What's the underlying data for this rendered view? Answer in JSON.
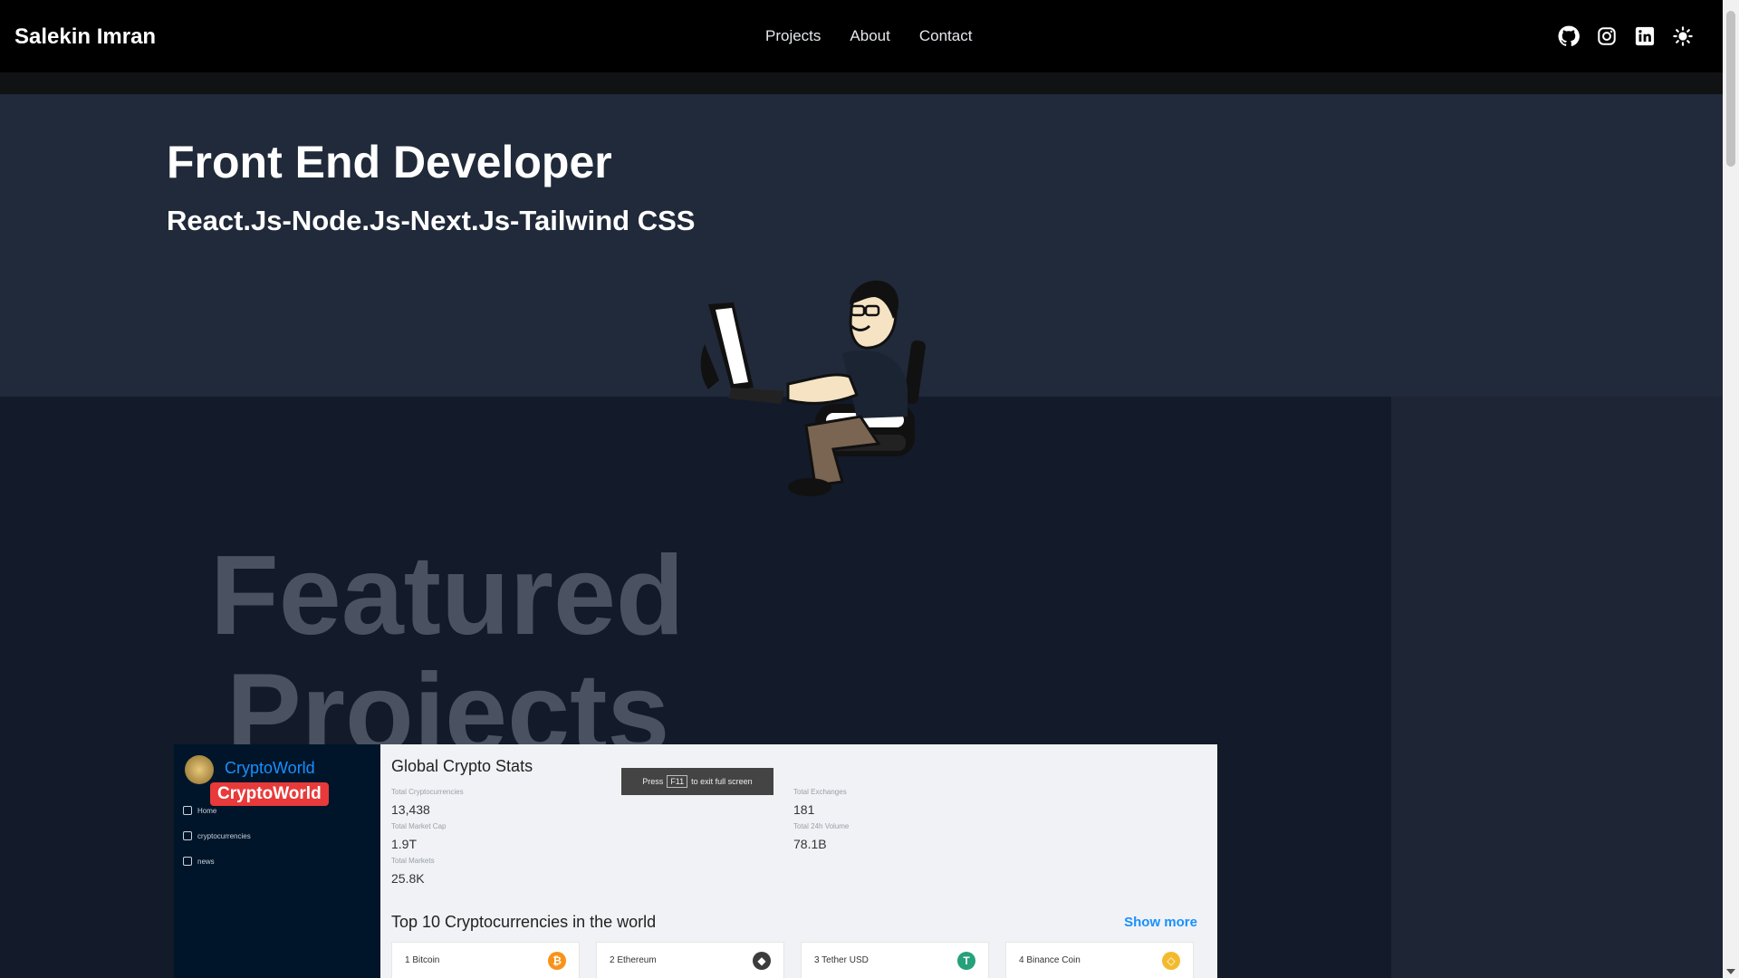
{
  "nav": {
    "brand": "Salekin Imran",
    "links": [
      "Projects",
      "About",
      "Contact"
    ],
    "icons": [
      "github-icon",
      "instagram-icon",
      "linkedin-icon",
      "sun-icon"
    ]
  },
  "hero": {
    "title": "Front End Developer",
    "subtitle": "React.Js-Node.Js-Next.Js-Tailwind CSS"
  },
  "projects": {
    "heading_line1": "Featured",
    "heading_line2": "Projects"
  },
  "preview": {
    "app_name": "CryptoWorld",
    "badge": "CryptoWorld",
    "sidebar": [
      "Home",
      "cryptocurrencies",
      "news"
    ],
    "stats_title": "Global Crypto Stats",
    "fullscreen_hint": {
      "before": "Press",
      "key": "F11",
      "after": "to exit full screen"
    },
    "stats": [
      {
        "label": "Total Cryptocurrencies",
        "value": "13,438"
      },
      {
        "label": "Total Exchanges",
        "value": "181"
      },
      {
        "label": "Total Market Cap",
        "value": "1.9T"
      },
      {
        "label": "Total 24h Volume",
        "value": "78.1B"
      },
      {
        "label": "Total Markets",
        "value": "25.8K"
      }
    ],
    "top_title": "Top 10 Cryptocurrencies in the world",
    "show_more": "Show more",
    "coins": [
      {
        "name": "1 Bitcoin",
        "color": "#f7931a",
        "glyph": "₿"
      },
      {
        "name": "2 Ethereum",
        "color": "#3c3c3d",
        "glyph": "◆"
      },
      {
        "name": "3 Tether USD",
        "color": "#26a17b",
        "glyph": "T"
      },
      {
        "name": "4 Binance Coin",
        "color": "#f3ba2f",
        "glyph": "◇"
      }
    ]
  }
}
